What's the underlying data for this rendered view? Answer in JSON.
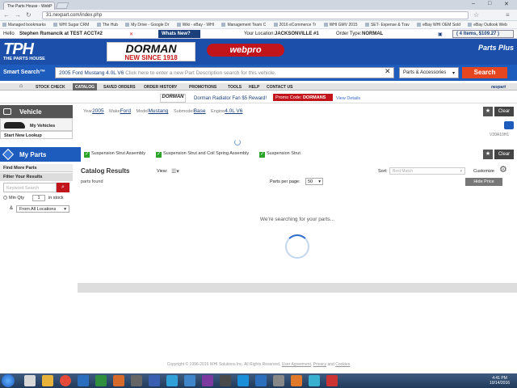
{
  "browser": {
    "tab_title": "The Parts House - WebP",
    "url": "31.nexpart.com/index.php",
    "window_controls": [
      "–",
      "□",
      "✕"
    ],
    "bookmarks": [
      "Managed bookmarks",
      "WHI Sugar CRM",
      "The Hub",
      "My Drive - Google Dr",
      "Wiki - eBay - WHI",
      "Management Team C",
      "2016 eCommerce Tr",
      "WHI GMV 2015",
      "SET- Expense & Trav",
      "eBay WHI OEM Sold",
      "eBay Outlook Web"
    ]
  },
  "site": {
    "greeting": "Hello",
    "user": "Stephen Rumancik at TEST ACCT#2",
    "logout": "✕",
    "whats_new": "Whats New?",
    "location_label": "Your Location:",
    "location": "JACKSONVILLE #1",
    "order_type_label": "Order Type:",
    "order_type": "NORMAL",
    "cart": "( 4 Items, $109.27 )",
    "logo_big": "TPH",
    "logo_small": "THE PARTS HOUSE",
    "ad_brand": "DORMAN",
    "ad_tagline": "NEW SINCE 1918",
    "webpro": "webpro",
    "partsplus": "Parts Plus"
  },
  "smart_search": {
    "label": "Smart Search™",
    "vehicle": "2005 Ford Mustang 4.0L V6",
    "hint": "Click here to enter a new Part Description search for this vehicle.",
    "category": "Parts & Accessories",
    "button": "Search"
  },
  "nav": {
    "items": [
      "STOCK CHECK",
      "CATALOG",
      "SAVED ORDERS",
      "ORDER HISTORY",
      "PROMOTIONS",
      "TOOLS",
      "HELP",
      "CONTACT US"
    ],
    "brand": "nexpart"
  },
  "promo": {
    "logo": "DORMAN",
    "text": "Dorman Radiator Fan $5 Reward!",
    "code_label": "Promo Code:",
    "code": "DORMANS",
    "details": "View Details"
  },
  "vehicle": {
    "header": "Vehicle",
    "my_vehicles": "My Vehicles",
    "start_new": "Start New Lookup",
    "year_label": "Year",
    "year": "2005",
    "make_label": "Make",
    "make": "Ford",
    "model_label": "Model",
    "model": "Mustang",
    "submodel_label": "Submodel",
    "submodel": "Base",
    "engine_label": "Engine",
    "engine": "4.0L V6",
    "clear": "Clear",
    "vid_code": "V20A10H1"
  },
  "parts": {
    "header": "My Parts",
    "find_more": "Find More Parts",
    "filter": "Filter Your Results",
    "keyword_placeholder": "Keyword Search",
    "min_qty": "Min Qty",
    "qty": "1",
    "in_stock": "in stock",
    "location_option": "From All Locations",
    "selected": [
      "Suspension Strut Assembly",
      "Suspension Strut and Coil Spring Assembly",
      "Suspension Strut"
    ],
    "clear": "Clear"
  },
  "catalog": {
    "title": "Catalog Results",
    "view_label": "View:",
    "sort_label": "Sort:",
    "sort_placeholder": "Best Match",
    "customize": "Customize",
    "parts_found": "parts found",
    "per_page_label": "Parts per page:",
    "per_page": "50",
    "hide_price": "Hide Price",
    "searching": "We're searching for your parts..."
  },
  "footer": {
    "copyright": "Copyright © 1996-2016 WHI Solutions Inc. All Rights Reserved.",
    "user_agreement": "User Agreement",
    "privacy": "Privacy",
    "and": "and",
    "cookies": "Cookies"
  },
  "taskbar": {
    "time": "4:41 PM",
    "date": "10/14/2016"
  }
}
